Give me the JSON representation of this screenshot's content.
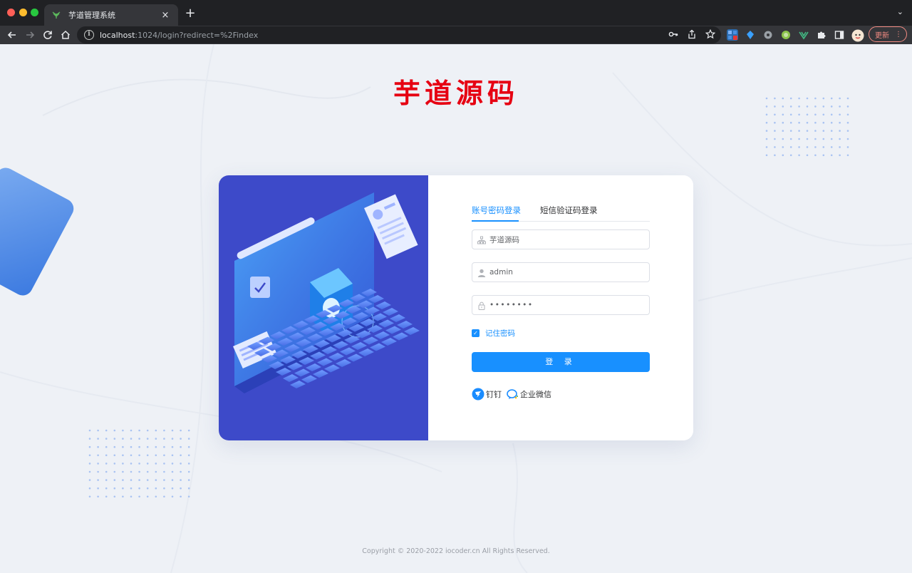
{
  "browser": {
    "tab_title": "芋道管理系统",
    "tab_close": "×",
    "new_tab": "+",
    "tab_menu": "⌄",
    "url_host": "localhost",
    "url_path": ":1024/login?redirect=%2Findex",
    "update_label": "更新",
    "update_menu": "⋮"
  },
  "brand": {
    "logo_text": "芋道源码",
    "logo_color": "#e60012"
  },
  "login": {
    "tabs": [
      "账号密码登录",
      "短信验证码登录"
    ],
    "tenant_value": "芋道源码",
    "username_value": "admin",
    "password_mask": "••••••••",
    "remember_label": "记住密码",
    "remember_checked": true,
    "submit_label": "登 录",
    "social": [
      {
        "label": "钉钉",
        "icon": "dingtalk-icon"
      },
      {
        "label": "企业微信",
        "icon": "wecom-icon"
      }
    ],
    "accent_color": "#1890ff"
  },
  "footer": {
    "copyright": "Copyright © 2020-2022 iocoder.cn All Rights Reserved."
  }
}
